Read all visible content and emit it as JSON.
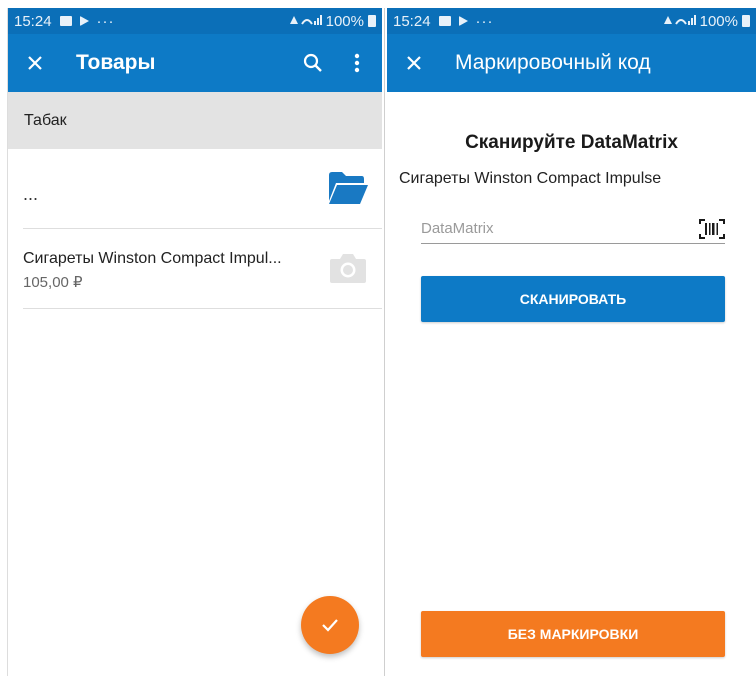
{
  "status_bar": {
    "time": "15:24",
    "dots": "···",
    "battery_text": "100%"
  },
  "left_screen": {
    "title": "Товары",
    "group_header": "Табак",
    "folder_item": {
      "label": "..."
    },
    "product": {
      "name": "Сигареты Winston Compact Impul...",
      "price": "105,00 ₽"
    }
  },
  "right_screen": {
    "title": "Маркировочный код",
    "scan_title": "Сканируйте DataMatrix",
    "product_name": "Сигареты Winston Compact Impulse",
    "datamatrix_placeholder": "DataMatrix",
    "scan_button": "СКАНИРОВАТЬ",
    "no_marking_button": "БЕЗ МАРКИРОВКИ"
  },
  "colors": {
    "status_bar": "#0b6fb8",
    "app_bar": "#0d7ac6",
    "accent_orange": "#f47a20",
    "group_header_bg": "#e3e3e3"
  },
  "icons": [
    "close-icon",
    "search-icon",
    "more-vert-icon",
    "folder-icon",
    "camera-icon",
    "check-icon",
    "barcode-icon"
  ]
}
